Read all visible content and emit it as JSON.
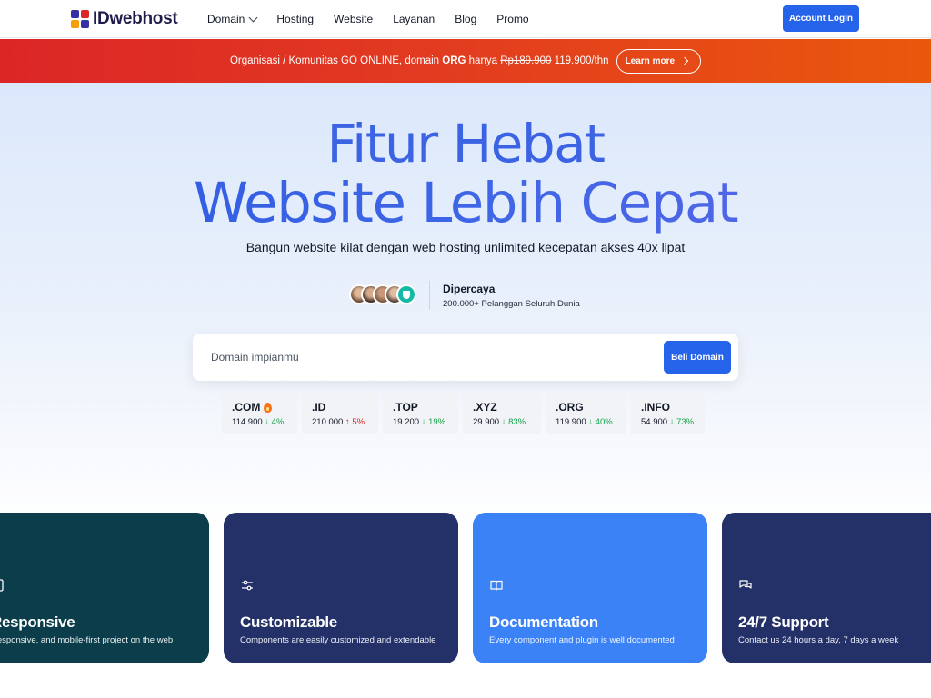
{
  "header": {
    "brand": "IDwebhost",
    "nav": [
      {
        "label": "Domain",
        "dropdown": true
      },
      {
        "label": "Hosting"
      },
      {
        "label": "Website"
      },
      {
        "label": "Layanan"
      },
      {
        "label": "Blog"
      },
      {
        "label": "Promo"
      }
    ],
    "login_label": "Account Login"
  },
  "promo": {
    "text_before": "Organisasi / Komunitas GO ONLINE, domain ",
    "highlight": "ORG",
    "text_middle": " hanya ",
    "old_price": "Rp189.900",
    "new_price": " 119.900/thn",
    "cta": "Learn more"
  },
  "hero": {
    "title_line1": "Fitur Hebat",
    "title_line2": "Website Lebih Cepat",
    "subtitle": "Bangun website kilat dengan web hosting unlimited kecepatan akses 40x lipat",
    "trust_title": "Dipercaya",
    "trust_subtitle": "200.000+ Pelanggan Seluruh Dunia"
  },
  "search": {
    "placeholder": "Domain impianmu",
    "button_label": "Beli Domain"
  },
  "tlds": [
    {
      "name": ".COM",
      "price": "114.900",
      "change": "4%",
      "direction": "down",
      "hot": true
    },
    {
      "name": ".ID",
      "price": "210.000",
      "change": "5%",
      "direction": "up"
    },
    {
      "name": ".TOP",
      "price": "19.200",
      "change": "19%",
      "direction": "down"
    },
    {
      "name": ".XYZ",
      "price": "29.900",
      "change": "83%",
      "direction": "down"
    },
    {
      "name": ".ORG",
      "price": "119.900",
      "change": "40%",
      "direction": "down"
    },
    {
      "name": ".INFO",
      "price": "54.900",
      "change": "73%",
      "direction": "down"
    }
  ],
  "features": [
    {
      "title": "Responsive",
      "description": "Responsive, and mobile-first project on the web",
      "icon": "tablet-icon",
      "color": "#0b3d4a"
    },
    {
      "title": "Customizable",
      "description": "Components are easily customized and extendable",
      "icon": "sliders-icon",
      "color": "#233168"
    },
    {
      "title": "Documentation",
      "description": "Every component and plugin is well documented",
      "icon": "book-icon",
      "color": "#3b82f6"
    },
    {
      "title": "24/7 Support",
      "description": "Contact us 24 hours a day, 7 days a week",
      "icon": "chat-icon",
      "color": "#233168"
    }
  ],
  "colors": {
    "primary": "#2563eb",
    "promo_start": "#dc2626",
    "promo_end": "#ea580c",
    "price_down": "#16a34a",
    "price_up": "#dc2626"
  }
}
